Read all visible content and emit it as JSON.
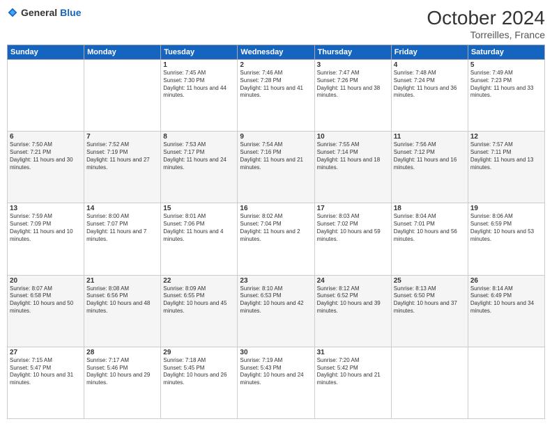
{
  "header": {
    "logo_general": "General",
    "logo_blue": "Blue",
    "month_title": "October 2024",
    "subtitle": "Torreilles, France"
  },
  "days_of_week": [
    "Sunday",
    "Monday",
    "Tuesday",
    "Wednesday",
    "Thursday",
    "Friday",
    "Saturday"
  ],
  "weeks": [
    [
      {
        "day": "",
        "sunrise": "",
        "sunset": "",
        "daylight": ""
      },
      {
        "day": "",
        "sunrise": "",
        "sunset": "",
        "daylight": ""
      },
      {
        "day": "1",
        "sunrise": "Sunrise: 7:45 AM",
        "sunset": "Sunset: 7:30 PM",
        "daylight": "Daylight: 11 hours and 44 minutes."
      },
      {
        "day": "2",
        "sunrise": "Sunrise: 7:46 AM",
        "sunset": "Sunset: 7:28 PM",
        "daylight": "Daylight: 11 hours and 41 minutes."
      },
      {
        "day": "3",
        "sunrise": "Sunrise: 7:47 AM",
        "sunset": "Sunset: 7:26 PM",
        "daylight": "Daylight: 11 hours and 38 minutes."
      },
      {
        "day": "4",
        "sunrise": "Sunrise: 7:48 AM",
        "sunset": "Sunset: 7:24 PM",
        "daylight": "Daylight: 11 hours and 36 minutes."
      },
      {
        "day": "5",
        "sunrise": "Sunrise: 7:49 AM",
        "sunset": "Sunset: 7:23 PM",
        "daylight": "Daylight: 11 hours and 33 minutes."
      }
    ],
    [
      {
        "day": "6",
        "sunrise": "Sunrise: 7:50 AM",
        "sunset": "Sunset: 7:21 PM",
        "daylight": "Daylight: 11 hours and 30 minutes."
      },
      {
        "day": "7",
        "sunrise": "Sunrise: 7:52 AM",
        "sunset": "Sunset: 7:19 PM",
        "daylight": "Daylight: 11 hours and 27 minutes."
      },
      {
        "day": "8",
        "sunrise": "Sunrise: 7:53 AM",
        "sunset": "Sunset: 7:17 PM",
        "daylight": "Daylight: 11 hours and 24 minutes."
      },
      {
        "day": "9",
        "sunrise": "Sunrise: 7:54 AM",
        "sunset": "Sunset: 7:16 PM",
        "daylight": "Daylight: 11 hours and 21 minutes."
      },
      {
        "day": "10",
        "sunrise": "Sunrise: 7:55 AM",
        "sunset": "Sunset: 7:14 PM",
        "daylight": "Daylight: 11 hours and 18 minutes."
      },
      {
        "day": "11",
        "sunrise": "Sunrise: 7:56 AM",
        "sunset": "Sunset: 7:12 PM",
        "daylight": "Daylight: 11 hours and 16 minutes."
      },
      {
        "day": "12",
        "sunrise": "Sunrise: 7:57 AM",
        "sunset": "Sunset: 7:11 PM",
        "daylight": "Daylight: 11 hours and 13 minutes."
      }
    ],
    [
      {
        "day": "13",
        "sunrise": "Sunrise: 7:59 AM",
        "sunset": "Sunset: 7:09 PM",
        "daylight": "Daylight: 11 hours and 10 minutes."
      },
      {
        "day": "14",
        "sunrise": "Sunrise: 8:00 AM",
        "sunset": "Sunset: 7:07 PM",
        "daylight": "Daylight: 11 hours and 7 minutes."
      },
      {
        "day": "15",
        "sunrise": "Sunrise: 8:01 AM",
        "sunset": "Sunset: 7:06 PM",
        "daylight": "Daylight: 11 hours and 4 minutes."
      },
      {
        "day": "16",
        "sunrise": "Sunrise: 8:02 AM",
        "sunset": "Sunset: 7:04 PM",
        "daylight": "Daylight: 11 hours and 2 minutes."
      },
      {
        "day": "17",
        "sunrise": "Sunrise: 8:03 AM",
        "sunset": "Sunset: 7:02 PM",
        "daylight": "Daylight: 10 hours and 59 minutes."
      },
      {
        "day": "18",
        "sunrise": "Sunrise: 8:04 AM",
        "sunset": "Sunset: 7:01 PM",
        "daylight": "Daylight: 10 hours and 56 minutes."
      },
      {
        "day": "19",
        "sunrise": "Sunrise: 8:06 AM",
        "sunset": "Sunset: 6:59 PM",
        "daylight": "Daylight: 10 hours and 53 minutes."
      }
    ],
    [
      {
        "day": "20",
        "sunrise": "Sunrise: 8:07 AM",
        "sunset": "Sunset: 6:58 PM",
        "daylight": "Daylight: 10 hours and 50 minutes."
      },
      {
        "day": "21",
        "sunrise": "Sunrise: 8:08 AM",
        "sunset": "Sunset: 6:56 PM",
        "daylight": "Daylight: 10 hours and 48 minutes."
      },
      {
        "day": "22",
        "sunrise": "Sunrise: 8:09 AM",
        "sunset": "Sunset: 6:55 PM",
        "daylight": "Daylight: 10 hours and 45 minutes."
      },
      {
        "day": "23",
        "sunrise": "Sunrise: 8:10 AM",
        "sunset": "Sunset: 6:53 PM",
        "daylight": "Daylight: 10 hours and 42 minutes."
      },
      {
        "day": "24",
        "sunrise": "Sunrise: 8:12 AM",
        "sunset": "Sunset: 6:52 PM",
        "daylight": "Daylight: 10 hours and 39 minutes."
      },
      {
        "day": "25",
        "sunrise": "Sunrise: 8:13 AM",
        "sunset": "Sunset: 6:50 PM",
        "daylight": "Daylight: 10 hours and 37 minutes."
      },
      {
        "day": "26",
        "sunrise": "Sunrise: 8:14 AM",
        "sunset": "Sunset: 6:49 PM",
        "daylight": "Daylight: 10 hours and 34 minutes."
      }
    ],
    [
      {
        "day": "27",
        "sunrise": "Sunrise: 7:15 AM",
        "sunset": "Sunset: 5:47 PM",
        "daylight": "Daylight: 10 hours and 31 minutes."
      },
      {
        "day": "28",
        "sunrise": "Sunrise: 7:17 AM",
        "sunset": "Sunset: 5:46 PM",
        "daylight": "Daylight: 10 hours and 29 minutes."
      },
      {
        "day": "29",
        "sunrise": "Sunrise: 7:18 AM",
        "sunset": "Sunset: 5:45 PM",
        "daylight": "Daylight: 10 hours and 26 minutes."
      },
      {
        "day": "30",
        "sunrise": "Sunrise: 7:19 AM",
        "sunset": "Sunset: 5:43 PM",
        "daylight": "Daylight: 10 hours and 24 minutes."
      },
      {
        "day": "31",
        "sunrise": "Sunrise: 7:20 AM",
        "sunset": "Sunset: 5:42 PM",
        "daylight": "Daylight: 10 hours and 21 minutes."
      },
      {
        "day": "",
        "sunrise": "",
        "sunset": "",
        "daylight": ""
      },
      {
        "day": "",
        "sunrise": "",
        "sunset": "",
        "daylight": ""
      }
    ]
  ]
}
